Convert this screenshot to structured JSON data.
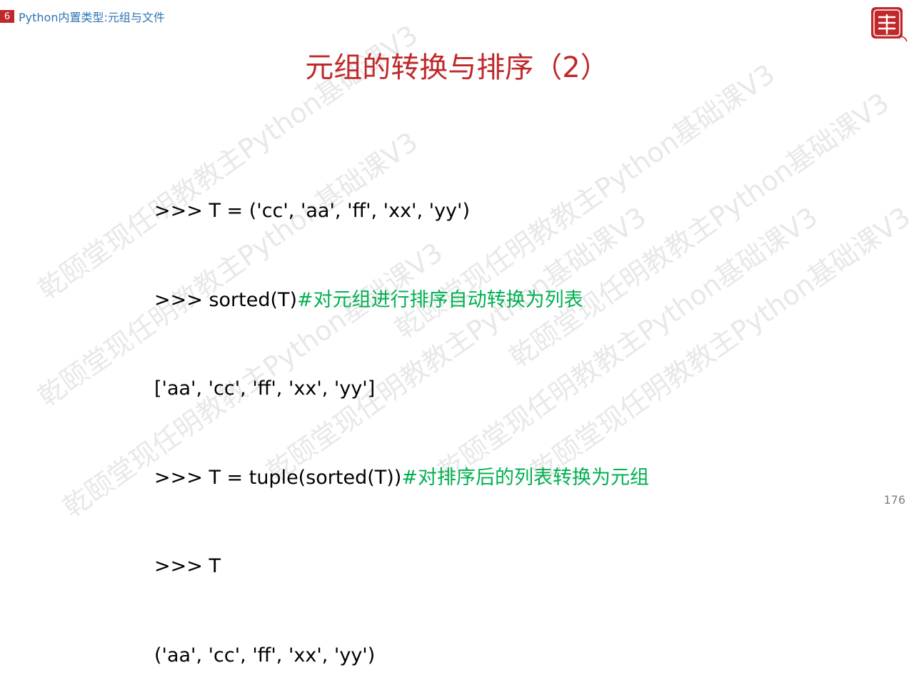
{
  "header": {
    "chapter_number": "6",
    "breadcrumb": "Python内置类型:元组与文件"
  },
  "logo": {
    "text": "乾颐堂"
  },
  "slide": {
    "title": "元组的转换与排序（2）",
    "code_lines": [
      {
        "code": ">>> T = ('cc', 'aa', 'ff', 'xx', 'yy')",
        "comment": ""
      },
      {
        "code": ">>> sorted(T)",
        "comment": "#对元组进行排序自动转换为列表"
      },
      {
        "code": "['aa', 'cc', 'ff', 'xx', 'yy']",
        "comment": ""
      },
      {
        "code": ">>> T = tuple(sorted(T))",
        "comment": "#对排序后的列表转换为元组"
      },
      {
        "code": ">>> T",
        "comment": ""
      },
      {
        "code": "('aa', 'cc', 'ff', 'xx', 'yy')",
        "comment": ""
      }
    ],
    "page_number": "176"
  },
  "watermark": {
    "text": "乾颐堂现任明教教主Python基础课V3"
  },
  "colors": {
    "title": "#c0282b",
    "comment": "#00b050",
    "breadcrumb": "#2e74b5",
    "badge": "#c0282b"
  }
}
